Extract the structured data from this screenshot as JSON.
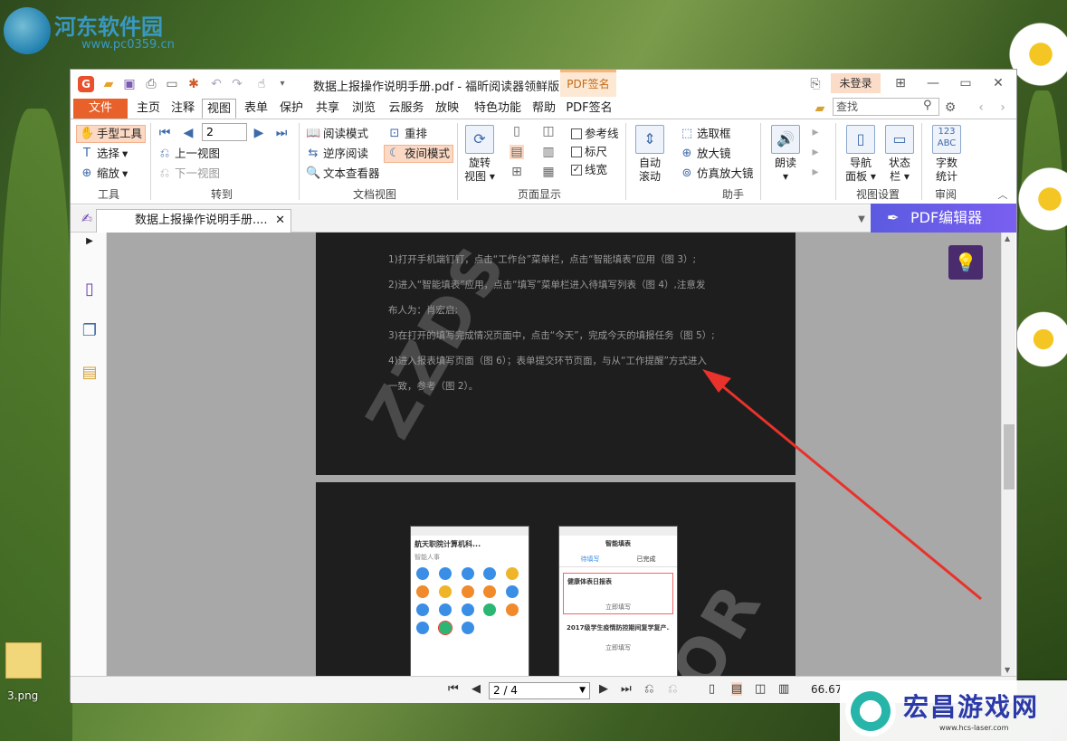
{
  "desktop": {
    "watermark_title": "河东软件园",
    "watermark_url": "www.pc0359.cn",
    "file_icon_label": "3.png",
    "brand_name": "宏昌游戏网",
    "brand_url": "www.hcs-laser.com"
  },
  "window": {
    "title": "数据上报操作说明手册.pdf - 福昕阅读器领鲜版",
    "context_tab_group": "PDF签名",
    "login_label": "未登录",
    "menu": [
      "主页",
      "注释",
      "视图",
      "表单",
      "保护",
      "共享",
      "浏览",
      "云服务",
      "放映",
      "特色功能",
      "帮助",
      "PDF签名"
    ],
    "file_label": "文件",
    "active_menu": "视图",
    "search_placeholder": "查找"
  },
  "ribbon": {
    "tools": {
      "hand": "手型工具",
      "select": "选择",
      "zoom": "缩放",
      "group": "工具"
    },
    "goto": {
      "page_value": "2",
      "prev_view": "上一视图",
      "next_view": "下一视图",
      "group": "转到"
    },
    "docview": {
      "read_mode": "阅读模式",
      "reverse": "逆序阅读",
      "text_viewer": "文本查看器",
      "reflow": "重排",
      "night": "夜间模式",
      "group": "文档视图"
    },
    "pagedisplay": {
      "rotate": "旋转\n视图",
      "guides": "参考线",
      "ruler": "标尺",
      "linewidth": "线宽",
      "group": "页面显示"
    },
    "assistant": {
      "autoscroll": "自动\n滚动",
      "marquee": "选取框",
      "magnifier": "放大镜",
      "loupe": "仿真放大镜",
      "group": "助手"
    },
    "read_aloud": "朗读",
    "viewsettings": {
      "nav": "导航\n面板",
      "status": "状态\n栏",
      "group": "视图设置"
    },
    "review": {
      "wordcount": "字数\n统计",
      "abc": "123\nABC",
      "group": "审阅"
    }
  },
  "tabs": {
    "doc_tab": "数据上报操作说明手册....",
    "pdf_editor": "PDF编辑器"
  },
  "page1_lines": [
    "1)打开手机端钉钉，点击“工作台”菜单栏，点击“智能填表”应用（图 3）;",
    "2)进入“智能填表”应用，点击“填写”菜单栏进入待填写列表（图 4）,注意发",
    "布人为：肖宏启;",
    "3)在打开的填写完成情况页面中，点击“今天”，完成今天的填报任务（图 5）;",
    "4)进入报表填写页面（图 6）；表单提交环节页面，与从“工作提醒”方式进入",
    "一致，参考（图 2）。"
  ],
  "page_watermarks": [
    "ZZDS",
    "TOR"
  ],
  "phone1": {
    "title": "航天职院计算机科...",
    "filter": "智能人事"
  },
  "phone2": {
    "title": "智能填表",
    "tab1": "待填写",
    "tab2": "已完成",
    "item1": "健康体表日报表",
    "item1_btn": "立即填写",
    "item2": "2017级学生疫情防控期间复学复产...",
    "item2_btn": "立即填写"
  },
  "statusbar": {
    "page_display": "2 / 4",
    "zoom": "66.67"
  },
  "colors": {
    "accent": "#e8612b",
    "night_bg": "#1e1e1e",
    "arrow": "#e8322b",
    "editor": "#6b5ee8"
  }
}
